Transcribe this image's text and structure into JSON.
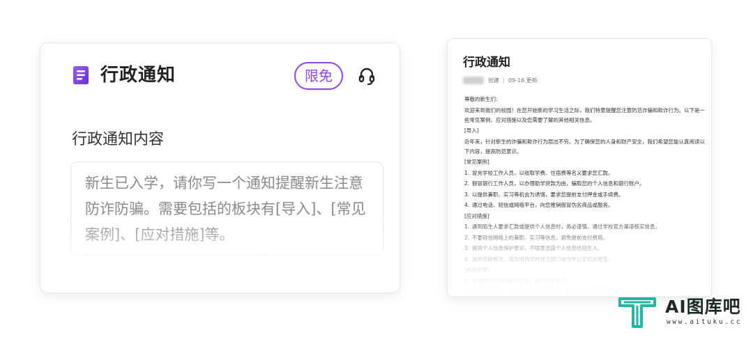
{
  "template_card": {
    "title": "行政通知",
    "badge": "限免",
    "field_label": "行政通知内容",
    "content_text": "新生已入学，请你写一个通知提醒新生注意防诈防骗。需要包括的板块有[导入]、[常见案例]、[应对措施]等。",
    "colors": {
      "accent": "#8e44ec",
      "icon_purple": "#7b3fe4"
    },
    "icons": [
      "document-icon",
      "headset-icon"
    ]
  },
  "document": {
    "title": "行政通知",
    "meta_created": "创建",
    "meta_updated": "09-16 更新",
    "greeting": "尊敬的新生们:",
    "intro_paragraph": "欢迎来到我们的校园！在您开始新的学习生活之际，我们特意提醒您注意防范诈骗和欺诈行为。以下是一些常见案例、应对措施以及您需要了解的其他相关信息。",
    "section_intro": "[导入]",
    "intro_text": "近年来，针对新生的诈骗和欺诈行为层出不穷。为了确保您的人身和财产安全，我们希望您能认真阅读以下内容，提高防范意识。",
    "section_cases": "[常见案例]",
    "cases": [
      "冒充学校工作人员，以收取学费、住宿费等名义要求您汇款。",
      "假冒银行工作人员，以办理助学贷款为由，骗取您的个人信息和银行账户。",
      "以提供兼职、实习等机会为诱饵，要求您提前支付押金或手续费。",
      "通过电话、短信或网络平台，向您推销假冒伪劣商品或服务。"
    ],
    "section_measures": "[应对措施]",
    "measures": [
      "遇到陌生人要求汇款或提供个人信息时，务必谨慎，通过学校官方渠道核实信息。",
      "不要轻信网络上的兼职、实习等信息，避免提前支付费用。",
      "提高个人信息保护意识，不随意透露个人信息给陌生人。",
      "遇到可疑情况，请及时向学校保卫部门或当地公安机关报告。"
    ],
    "section_tips": "[内容提要]",
    "tips": [
      "注意防范诈骗和欺诈行为，提高防范意识。",
      "遇到可疑情况，通过官方渠道核实信息，并向有关部门报告。"
    ]
  },
  "watermark": {
    "name": "AI图库吧",
    "url": "www.aituku.cc",
    "color": "#1fb8a6"
  }
}
